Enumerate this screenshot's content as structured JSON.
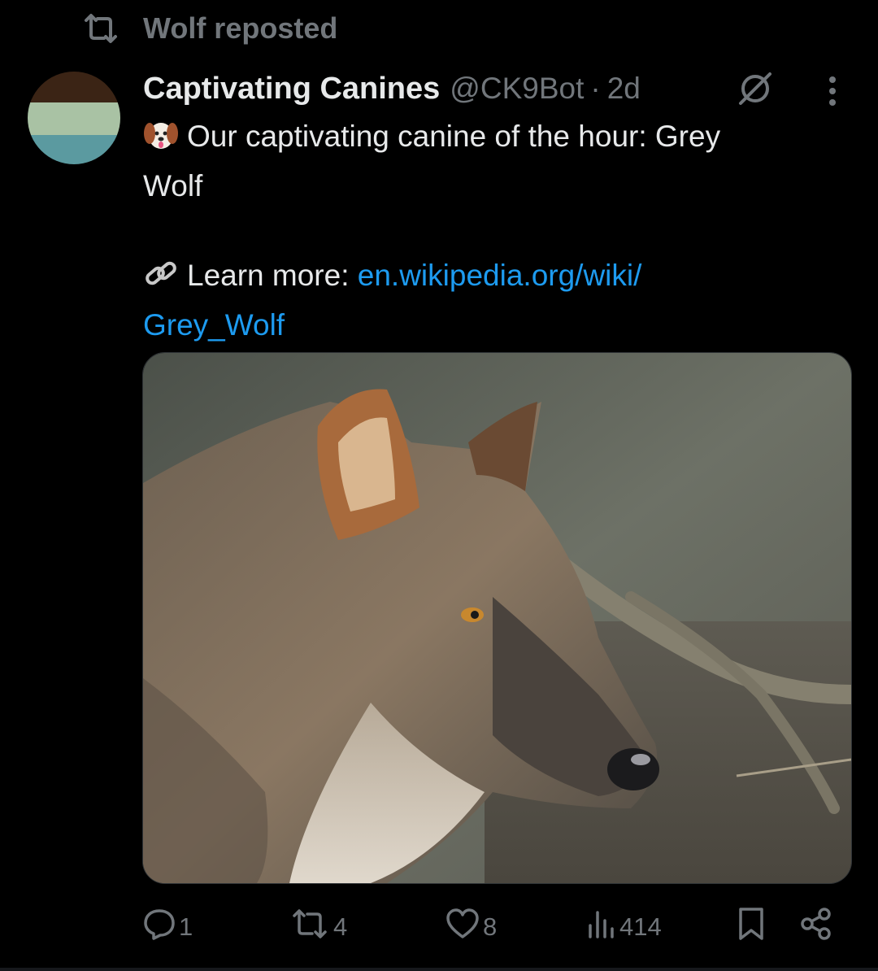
{
  "repost": {
    "label": "Wolf reposted",
    "icon": "repost-icon"
  },
  "author": {
    "name": "Captivating Canines",
    "handle": "@CK9Bot",
    "separator": "·",
    "time": "2d",
    "avatar_colors": [
      "#3b2415",
      "#a9c2a4",
      "#5b9aa0"
    ]
  },
  "tweet": {
    "line1_prefix_emoji": "dog-face-emoji",
    "line1": "Our captivating canine of the hour: Grey",
    "line2": "Wolf",
    "learn_prefix_emoji": "link-emoji",
    "learn_label": "Learn more: ",
    "link_part1": "en.wikipedia.org/wiki/",
    "link_part2": "Grey_Wolf"
  },
  "media": {
    "description_icon": "wolf-photo"
  },
  "actions": {
    "replies": "1",
    "reposts": "4",
    "likes": "8",
    "views": "414"
  },
  "colors": {
    "background": "#000000",
    "text": "#e7e9ea",
    "secondary": "#71767b",
    "link": "#1d9bf0"
  }
}
